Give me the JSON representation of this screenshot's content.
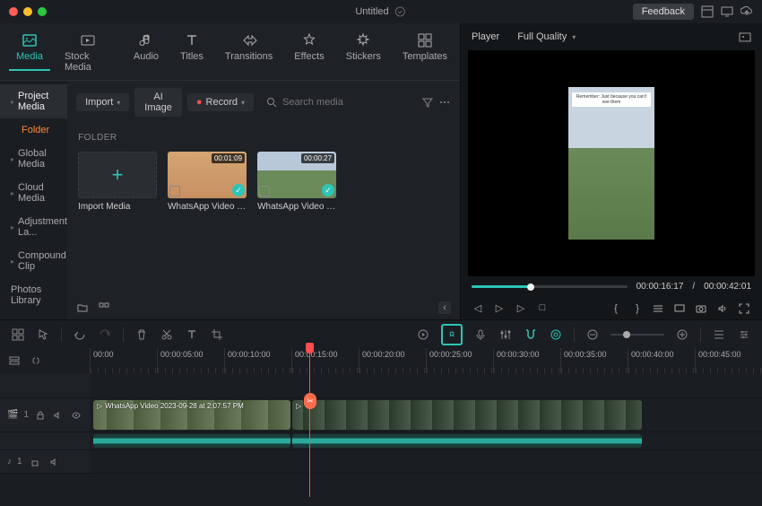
{
  "title": "Untitled",
  "titlebar": {
    "feedback": "Feedback"
  },
  "tabs": [
    {
      "label": "Media",
      "icon": "media"
    },
    {
      "label": "Stock Media",
      "icon": "stock"
    },
    {
      "label": "Audio",
      "icon": "audio"
    },
    {
      "label": "Titles",
      "icon": "titles"
    },
    {
      "label": "Transitions",
      "icon": "transitions"
    },
    {
      "label": "Effects",
      "icon": "effects"
    },
    {
      "label": "Stickers",
      "icon": "stickers"
    },
    {
      "label": "Templates",
      "icon": "templates"
    }
  ],
  "sidebar": {
    "items": [
      {
        "label": "Project Media",
        "type": "header"
      },
      {
        "label": "Folder",
        "type": "sub"
      },
      {
        "label": "Global Media",
        "type": "item"
      },
      {
        "label": "Cloud Media",
        "type": "item"
      },
      {
        "label": "Adjustment La...",
        "type": "item"
      },
      {
        "label": "Compound Clip",
        "type": "item"
      },
      {
        "label": "Photos Library",
        "type": "item"
      }
    ]
  },
  "toolbar": {
    "import": "Import",
    "ai_image": "AI Image",
    "record": "Record",
    "search_placeholder": "Search media"
  },
  "folder_label": "FOLDER",
  "media_items": [
    {
      "type": "import",
      "label": "Import Media"
    },
    {
      "type": "video",
      "duration": "00:01:09",
      "label": "WhatsApp Video 202..."
    },
    {
      "type": "video",
      "duration": "00:00:27",
      "label": "WhatsApp Video 202..."
    }
  ],
  "player": {
    "label": "Player",
    "quality": "Full Quality",
    "caption": "Remember: Just because you can't see them",
    "current_time": "00:00:16:17",
    "total_time": "00:00:42:01",
    "sep": "/"
  },
  "ruler": [
    "00:00",
    "00:00:05:00",
    "00:00:10:00",
    "00:00:15:00",
    "00:00:20:00",
    "00:00:25:00",
    "00:00:30:00",
    "00:00:35:00",
    "00:00:40:00",
    "00:00:45:00"
  ],
  "tracks": {
    "video_label": "1",
    "audio_label": "1",
    "clip1_label": "WhatsApp Video 2023-09-28 at 2:07:57 PM"
  },
  "icons": {
    "video": "🎬",
    "audio": "♪"
  }
}
